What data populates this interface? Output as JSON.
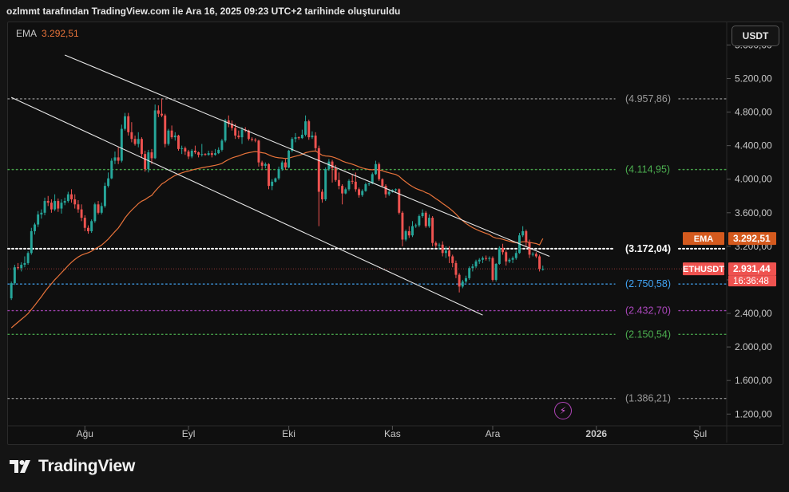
{
  "header": {
    "title": "ozlmmt tarafından TradingView.com ile Ara 16, 2025 09:23 UTC+2 tarihinde oluşturuldu"
  },
  "legend": {
    "ema_label": "EMA",
    "ema_value": "3.292,51"
  },
  "currency_button": "USDT",
  "brand": "TradingView",
  "colors": {
    "up": "#26a69a",
    "down": "#ef5350",
    "ema": "#e8733a",
    "channel": "#e8e8e8"
  },
  "badges": {
    "ema": {
      "label": "EMA",
      "value": "3.292,51"
    },
    "price": {
      "label": "ETHUSDT",
      "value": "2.931,44",
      "countdown": "16:36:48"
    }
  },
  "chart_data": {
    "type": "candlestick",
    "symbol": "ETHUSDT",
    "y_ticks": [
      1200,
      1600,
      2000,
      2400,
      2800,
      3200,
      3600,
      4000,
      4400,
      4800,
      5200,
      5600
    ],
    "y_tick_labels": [
      "1.200,00",
      "1.600,00",
      "2.000,00",
      "2.400,00",
      "2.800,00",
      "3.200,00",
      "3.600,00",
      "4.000,00",
      "4.400,00",
      "4.800,00",
      "5.200,00",
      "5.600,00"
    ],
    "ylim": [
      1060,
      5870
    ],
    "x_ticks": [
      {
        "label": "Ağu",
        "date": "2025-08-01"
      },
      {
        "label": "Eyl",
        "date": "2025-09-01"
      },
      {
        "label": "Eki",
        "date": "2025-10-01"
      },
      {
        "label": "Kas",
        "date": "2025-11-01"
      },
      {
        "label": "Ara",
        "date": "2025-12-01"
      },
      {
        "label": "2026",
        "date": "2026-01-01"
      },
      {
        "label": "Şul",
        "date": "2026-02-01"
      }
    ],
    "xlim": [
      "2025-07-09",
      "2026-02-09"
    ],
    "levels": [
      {
        "value": 4957.86,
        "label": "(4.957,86)",
        "color": "#9a9a9a",
        "label_color": "#9a9a9a"
      },
      {
        "value": 4114.95,
        "label": "(4.114,95)",
        "color": "#4caf50",
        "label_color": "#4caf50"
      },
      {
        "value": 3172.04,
        "label": "(3.172,04)",
        "color": "#ffffff",
        "label_color": "#ffffff"
      },
      {
        "value": 2750.58,
        "label": "(2.750,58)",
        "color": "#42a5f5",
        "label_color": "#42a5f5"
      },
      {
        "value": 2432.7,
        "label": "(2.432,70)",
        "color": "#ab47bc",
        "label_color": "#ab47bc"
      },
      {
        "value": 2150.54,
        "label": "(2.150,54)",
        "color": "#4caf50",
        "label_color": "#4caf50"
      },
      {
        "value": 1386.21,
        "label": "(1.386,21)",
        "color": "#9a9a9a",
        "label_color": "#9a9a9a"
      }
    ],
    "channel": [
      {
        "start": {
          "date": "2025-07-26",
          "value": 5480
        },
        "end": {
          "date": "2025-12-18",
          "value": 3080
        }
      },
      {
        "start": {
          "date": "2025-07-10",
          "value": 4975
        },
        "end": {
          "date": "2025-11-28",
          "value": 2380
        }
      }
    ],
    "last_price": 2931.44,
    "ema_last": 3292.51,
    "candles": [
      [
        "2025-07-10",
        2580,
        2780,
        2560,
        2760
      ],
      [
        "2025-07-11",
        2760,
        2980,
        2740,
        2950
      ],
      [
        "2025-07-12",
        2950,
        3000,
        2920,
        2940
      ],
      [
        "2025-07-13",
        2940,
        3010,
        2900,
        2980
      ],
      [
        "2025-07-14",
        2980,
        3080,
        2950,
        3000
      ],
      [
        "2025-07-15",
        3000,
        3140,
        2980,
        3120
      ],
      [
        "2025-07-16",
        3120,
        3420,
        3100,
        3380
      ],
      [
        "2025-07-17",
        3380,
        3480,
        3340,
        3460
      ],
      [
        "2025-07-18",
        3460,
        3620,
        3430,
        3580
      ],
      [
        "2025-07-19",
        3580,
        3640,
        3530,
        3600
      ],
      [
        "2025-07-20",
        3600,
        3780,
        3570,
        3740
      ],
      [
        "2025-07-21",
        3740,
        3800,
        3680,
        3720
      ],
      [
        "2025-07-22",
        3720,
        3760,
        3600,
        3640
      ],
      [
        "2025-07-23",
        3640,
        3820,
        3620,
        3740
      ],
      [
        "2025-07-24",
        3740,
        3770,
        3610,
        3650
      ],
      [
        "2025-07-25",
        3650,
        3760,
        3590,
        3720
      ],
      [
        "2025-07-26",
        3720,
        3780,
        3690,
        3740
      ],
      [
        "2025-07-27",
        3740,
        3850,
        3720,
        3820
      ],
      [
        "2025-07-28",
        3820,
        3880,
        3720,
        3760
      ],
      [
        "2025-07-29",
        3760,
        3820,
        3650,
        3700
      ],
      [
        "2025-07-30",
        3700,
        3750,
        3600,
        3640
      ],
      [
        "2025-07-31",
        3640,
        3700,
        3500,
        3540
      ],
      [
        "2025-08-01",
        3540,
        3570,
        3380,
        3420
      ],
      [
        "2025-08-02",
        3420,
        3450,
        3350,
        3380
      ],
      [
        "2025-08-03",
        3380,
        3520,
        3360,
        3500
      ],
      [
        "2025-08-04",
        3500,
        3720,
        3480,
        3700
      ],
      [
        "2025-08-05",
        3700,
        3740,
        3580,
        3600
      ],
      [
        "2025-08-06",
        3600,
        3720,
        3580,
        3680
      ],
      [
        "2025-08-07",
        3680,
        3960,
        3660,
        3920
      ],
      [
        "2025-08-08",
        3920,
        4080,
        3900,
        4010
      ],
      [
        "2025-08-09",
        4010,
        4250,
        4000,
        4220
      ],
      [
        "2025-08-10",
        4220,
        4330,
        4180,
        4260
      ],
      [
        "2025-08-11",
        4260,
        4380,
        4180,
        4220
      ],
      [
        "2025-08-12",
        4220,
        4650,
        4200,
        4600
      ],
      [
        "2025-08-13",
        4600,
        4790,
        4580,
        4750
      ],
      [
        "2025-08-14",
        4750,
        4790,
        4520,
        4560
      ],
      [
        "2025-08-15",
        4560,
        4680,
        4440,
        4480
      ],
      [
        "2025-08-16",
        4480,
        4520,
        4400,
        4420
      ],
      [
        "2025-08-17",
        4420,
        4560,
        4380,
        4480
      ],
      [
        "2025-08-18",
        4480,
        4500,
        4260,
        4300
      ],
      [
        "2025-08-19",
        4300,
        4340,
        4090,
        4120
      ],
      [
        "2025-08-20",
        4120,
        4350,
        4080,
        4320
      ],
      [
        "2025-08-21",
        4320,
        4360,
        4180,
        4250
      ],
      [
        "2025-08-22",
        4250,
        4890,
        4240,
        4820
      ],
      [
        "2025-08-23",
        4820,
        4880,
        4740,
        4780
      ],
      [
        "2025-08-24",
        4780,
        4960,
        4740,
        4760
      ],
      [
        "2025-08-25",
        4760,
        4780,
        4380,
        4420
      ],
      [
        "2025-08-26",
        4420,
        4600,
        4400,
        4580
      ],
      [
        "2025-08-27",
        4580,
        4640,
        4480,
        4500
      ],
      [
        "2025-08-28",
        4500,
        4560,
        4460,
        4520
      ],
      [
        "2025-08-29",
        4520,
        4530,
        4340,
        4360
      ],
      [
        "2025-08-30",
        4360,
        4400,
        4300,
        4370
      ],
      [
        "2025-08-31",
        4370,
        4390,
        4290,
        4330
      ],
      [
        "2025-09-01",
        4330,
        4350,
        4240,
        4270
      ],
      [
        "2025-09-02",
        4270,
        4360,
        4250,
        4340
      ],
      [
        "2025-09-03",
        4340,
        4400,
        4300,
        4320
      ],
      [
        "2025-09-04",
        4320,
        4330,
        4260,
        4290
      ],
      [
        "2025-09-05",
        4290,
        4420,
        4270,
        4300
      ],
      [
        "2025-09-06",
        4300,
        4310,
        4280,
        4290
      ],
      [
        "2025-09-07",
        4290,
        4340,
        4280,
        4310
      ],
      [
        "2025-09-08",
        4310,
        4340,
        4260,
        4290
      ],
      [
        "2025-09-09",
        4290,
        4360,
        4280,
        4310
      ],
      [
        "2025-09-10",
        4310,
        4380,
        4300,
        4350
      ],
      [
        "2025-09-11",
        4350,
        4480,
        4330,
        4460
      ],
      [
        "2025-09-12",
        4460,
        4720,
        4440,
        4700
      ],
      [
        "2025-09-13",
        4700,
        4760,
        4620,
        4660
      ],
      [
        "2025-09-14",
        4660,
        4700,
        4580,
        4610
      ],
      [
        "2025-09-15",
        4610,
        4660,
        4480,
        4520
      ],
      [
        "2025-09-16",
        4520,
        4580,
        4480,
        4500
      ],
      [
        "2025-09-17",
        4500,
        4620,
        4420,
        4590
      ],
      [
        "2025-09-18",
        4590,
        4620,
        4560,
        4580
      ],
      [
        "2025-09-19",
        4580,
        4590,
        4460,
        4480
      ],
      [
        "2025-09-20",
        4480,
        4500,
        4450,
        4470
      ],
      [
        "2025-09-21",
        4470,
        4490,
        4440,
        4460
      ],
      [
        "2025-09-22",
        4460,
        4470,
        4150,
        4200
      ],
      [
        "2025-09-23",
        4200,
        4220,
        4120,
        4160
      ],
      [
        "2025-09-24",
        4160,
        4200,
        4130,
        4180
      ],
      [
        "2025-09-25",
        4180,
        4190,
        3880,
        3920
      ],
      [
        "2025-09-26",
        3920,
        4000,
        3870,
        3970
      ],
      [
        "2025-09-27",
        3970,
        4020,
        3960,
        4010
      ],
      [
        "2025-09-28",
        4010,
        4150,
        3990,
        4120
      ],
      [
        "2025-09-29",
        4120,
        4220,
        4100,
        4200
      ],
      [
        "2025-09-30",
        4200,
        4240,
        4110,
        4140
      ],
      [
        "2025-10-01",
        4140,
        4350,
        4130,
        4340
      ],
      [
        "2025-10-02",
        4340,
        4500,
        4320,
        4480
      ],
      [
        "2025-10-03",
        4480,
        4550,
        4440,
        4500
      ],
      [
        "2025-10-04",
        4500,
        4510,
        4470,
        4490
      ],
      [
        "2025-10-05",
        4490,
        4590,
        4480,
        4530
      ],
      [
        "2025-10-06",
        4530,
        4760,
        4510,
        4690
      ],
      [
        "2025-10-07",
        4690,
        4710,
        4470,
        4500
      ],
      [
        "2025-10-08",
        4500,
        4570,
        4480,
        4520
      ],
      [
        "2025-10-09",
        4520,
        4560,
        4340,
        4370
      ],
      [
        "2025-10-10",
        4370,
        4400,
        3440,
        3850
      ],
      [
        "2025-10-11",
        3850,
        3880,
        3720,
        3760
      ],
      [
        "2025-10-12",
        3760,
        4140,
        3740,
        4120
      ],
      [
        "2025-10-13",
        4120,
        4240,
        4100,
        4210
      ],
      [
        "2025-10-14",
        4210,
        4230,
        3960,
        4130
      ],
      [
        "2025-10-15",
        4130,
        4170,
        3970,
        3990
      ],
      [
        "2025-10-16",
        3990,
        4080,
        3880,
        3920
      ],
      [
        "2025-10-17",
        3920,
        3940,
        3700,
        3830
      ],
      [
        "2025-10-18",
        3830,
        3900,
        3820,
        3880
      ],
      [
        "2025-10-19",
        3880,
        4000,
        3860,
        3980
      ],
      [
        "2025-10-20",
        3980,
        4060,
        3940,
        3970
      ],
      [
        "2025-10-21",
        3970,
        4080,
        3850,
        3880
      ],
      [
        "2025-10-22",
        3880,
        3900,
        3780,
        3810
      ],
      [
        "2025-10-23",
        3810,
        3880,
        3790,
        3860
      ],
      [
        "2025-10-24",
        3860,
        3960,
        3850,
        3940
      ],
      [
        "2025-10-25",
        3940,
        3960,
        3920,
        3950
      ],
      [
        "2025-10-26",
        3950,
        4080,
        3940,
        4060
      ],
      [
        "2025-10-27",
        4060,
        4220,
        4050,
        4180
      ],
      [
        "2025-10-28",
        4180,
        4200,
        3980,
        4000
      ],
      [
        "2025-10-29",
        4000,
        4010,
        3900,
        3920
      ],
      [
        "2025-10-30",
        3920,
        3940,
        3780,
        3820
      ],
      [
        "2025-10-31",
        3820,
        3880,
        3800,
        3850
      ],
      [
        "2025-11-01",
        3850,
        3880,
        3840,
        3870
      ],
      [
        "2025-11-02",
        3870,
        3890,
        3850,
        3880
      ],
      [
        "2025-11-03",
        3880,
        3890,
        3580,
        3600
      ],
      [
        "2025-11-04",
        3600,
        3620,
        3200,
        3280
      ],
      [
        "2025-11-05",
        3280,
        3400,
        3260,
        3380
      ],
      [
        "2025-11-06",
        3380,
        3440,
        3300,
        3330
      ],
      [
        "2025-11-07",
        3330,
        3500,
        3310,
        3440
      ],
      [
        "2025-11-08",
        3440,
        3470,
        3420,
        3450
      ],
      [
        "2025-11-09",
        3450,
        3580,
        3430,
        3560
      ],
      [
        "2025-11-10",
        3560,
        3640,
        3540,
        3600
      ],
      [
        "2025-11-11",
        3600,
        3620,
        3420,
        3440
      ],
      [
        "2025-11-12",
        3440,
        3580,
        3420,
        3540
      ],
      [
        "2025-11-13",
        3540,
        3560,
        3200,
        3240
      ],
      [
        "2025-11-14",
        3240,
        3260,
        3180,
        3210
      ],
      [
        "2025-11-15",
        3210,
        3240,
        3160,
        3220
      ],
      [
        "2025-11-16",
        3220,
        3260,
        3080,
        3120
      ],
      [
        "2025-11-17",
        3120,
        3200,
        3060,
        3150
      ],
      [
        "2025-11-18",
        3150,
        3200,
        3000,
        3080
      ],
      [
        "2025-11-19",
        3080,
        3100,
        2950,
        3000
      ],
      [
        "2025-11-20",
        3000,
        3030,
        2820,
        2860
      ],
      [
        "2025-11-21",
        2860,
        2880,
        2650,
        2720
      ],
      [
        "2025-11-22",
        2720,
        2800,
        2700,
        2780
      ],
      [
        "2025-11-23",
        2780,
        2850,
        2760,
        2820
      ],
      [
        "2025-11-24",
        2820,
        2960,
        2800,
        2940
      ],
      [
        "2025-11-25",
        2940,
        2990,
        2900,
        2960
      ],
      [
        "2025-11-26",
        2960,
        3040,
        2940,
        3020
      ],
      [
        "2025-11-27",
        3020,
        3060,
        2990,
        3040
      ],
      [
        "2025-11-28",
        3040,
        3080,
        3000,
        3060
      ],
      [
        "2025-11-29",
        3060,
        3090,
        3030,
        3050
      ],
      [
        "2025-11-30",
        3050,
        3080,
        3020,
        3060
      ],
      [
        "2025-12-01",
        3060,
        3080,
        2780,
        2800
      ],
      [
        "2025-12-02",
        2800,
        3000,
        2780,
        2990
      ],
      [
        "2025-12-03",
        2990,
        3200,
        2980,
        3180
      ],
      [
        "2025-12-04",
        3180,
        3230,
        3100,
        3130
      ],
      [
        "2025-12-05",
        3130,
        3150,
        2970,
        3020
      ],
      [
        "2025-12-06",
        3020,
        3060,
        3000,
        3040
      ],
      [
        "2025-12-07",
        3040,
        3080,
        3000,
        3060
      ],
      [
        "2025-12-08",
        3060,
        3150,
        3040,
        3120
      ],
      [
        "2025-12-09",
        3120,
        3360,
        3110,
        3330
      ],
      [
        "2025-12-10",
        3330,
        3440,
        3310,
        3380
      ],
      [
        "2025-12-11",
        3380,
        3400,
        3200,
        3250
      ],
      [
        "2025-12-12",
        3250,
        3280,
        3060,
        3100
      ],
      [
        "2025-12-13",
        3100,
        3130,
        3080,
        3110
      ],
      [
        "2025-12-14",
        3110,
        3130,
        3060,
        3080
      ],
      [
        "2025-12-15",
        3080,
        3100,
        2900,
        2930
      ],
      [
        "2025-12-16",
        2930,
        2970,
        2910,
        2931.44
      ]
    ]
  }
}
